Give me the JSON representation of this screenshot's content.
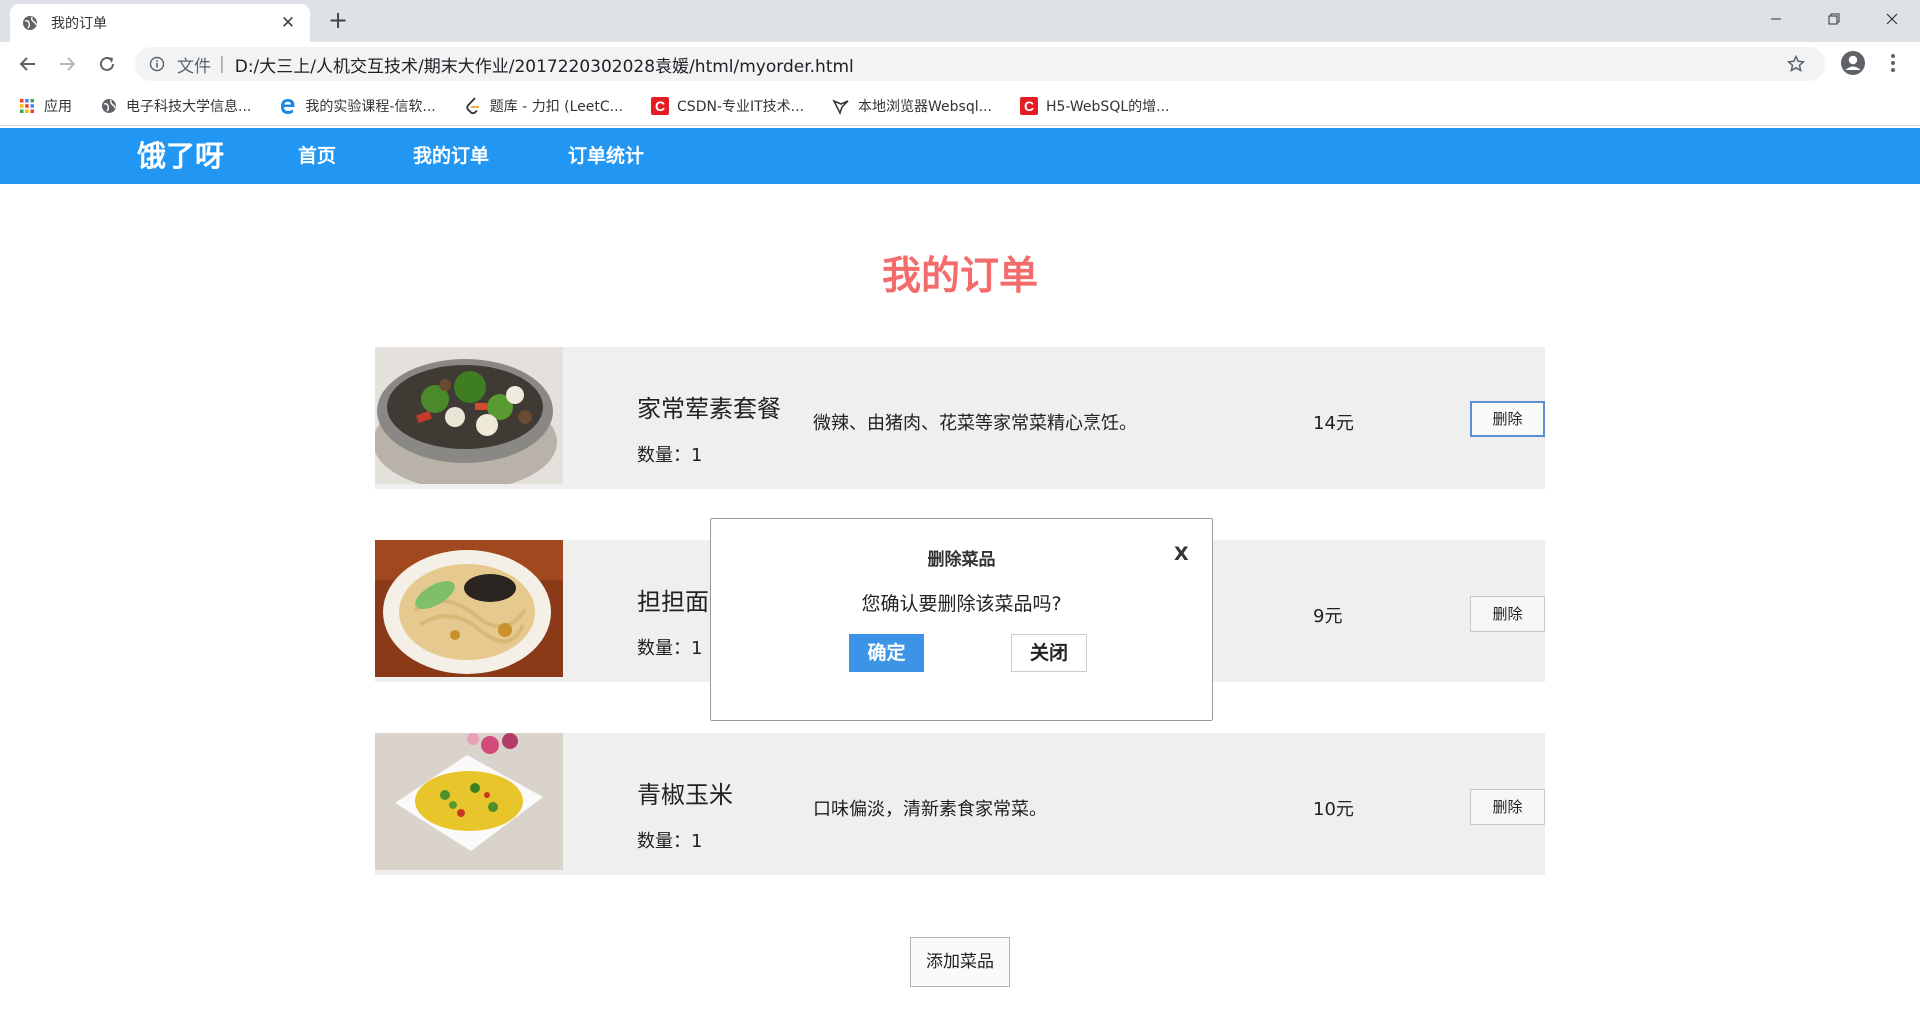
{
  "browser": {
    "tab_title": "我的订单",
    "omnibox_scheme": "文件",
    "omnibox_separator": "|",
    "url": "D:/大三上/人机交互技术/期末大作业/2017220302028袁媛/html/myorder.html",
    "bookmarks": [
      {
        "label": "应用",
        "icon": "apps-grid-icon"
      },
      {
        "label": "电子科技大学信息...",
        "icon": "globe-icon"
      },
      {
        "label": "我的实验课程-信软...",
        "icon": "edge-e-icon"
      },
      {
        "label": "题库 - 力扣 (LeetC...",
        "icon": "leetcode-icon"
      },
      {
        "label": "CSDN-专业IT技术...",
        "icon": "csdn-icon"
      },
      {
        "label": "本地浏览器Websql...",
        "icon": "feather-icon"
      },
      {
        "label": "H5-WebSQL的增...",
        "icon": "csdn-icon"
      }
    ]
  },
  "site": {
    "brand": "饿了呀",
    "nav": [
      "首页",
      "我的订单",
      "订单统计"
    ],
    "brand_color": "#2196f3",
    "title_color": "#f36b6b"
  },
  "page": {
    "title": "我的订单",
    "orders": [
      {
        "name": "家常荤素套餐",
        "qty": "数量：1",
        "desc": "微辣、由猪肉、花菜等家常菜精心烹饪。",
        "price": "14元",
        "delete": "删除"
      },
      {
        "name": "担担面",
        "qty": "数量：1",
        "desc": "",
        "price": "9元",
        "delete": "删除"
      },
      {
        "name": "青椒玉米",
        "qty": "数量：1",
        "desc": "口味偏淡，清新素食家常菜。",
        "price": "10元",
        "delete": "删除"
      }
    ],
    "add_button": "添加菜品"
  },
  "modal": {
    "title": "删除菜品",
    "close": "X",
    "message": "您确认要删除该菜品吗?",
    "confirm": "确定",
    "cancel": "关闭"
  }
}
